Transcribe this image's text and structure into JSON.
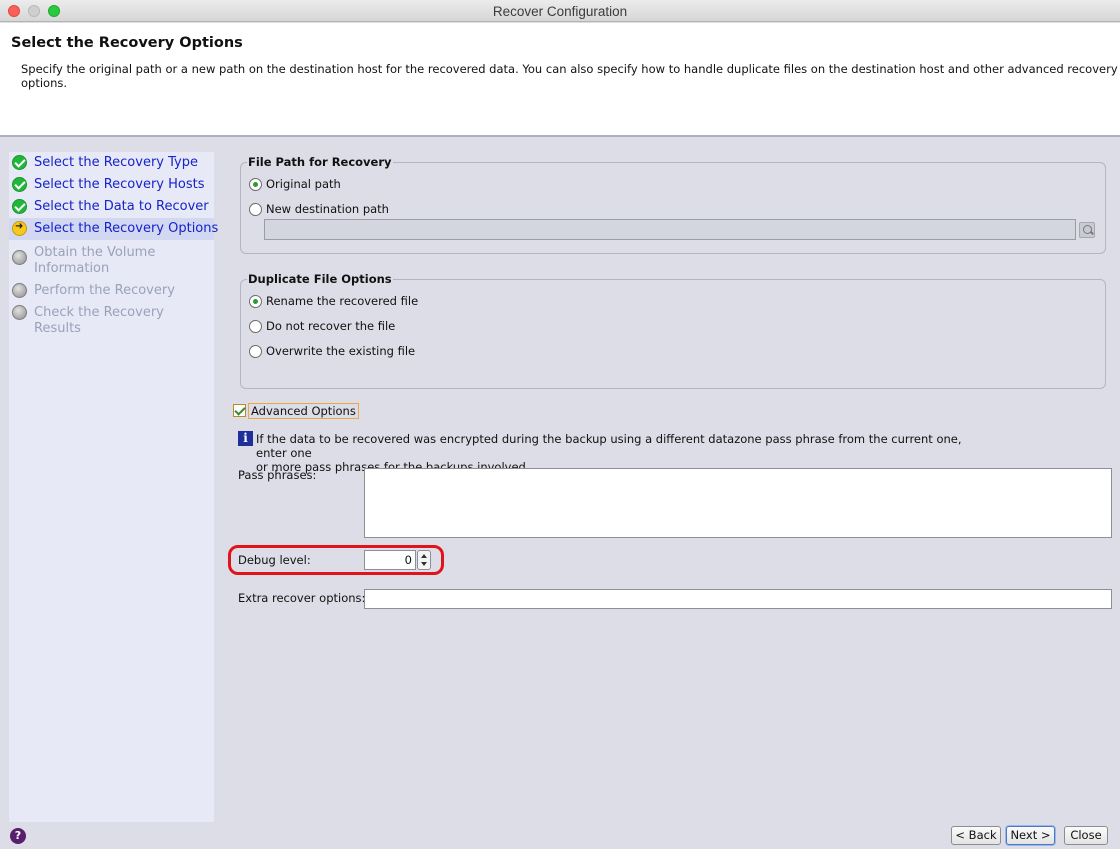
{
  "window": {
    "title": "Recover Configuration"
  },
  "header": {
    "title": "Select the Recovery Options",
    "description": "Specify the original path or a new path on the destination host for the recovered data. You can also specify how to handle duplicate files on the destination host and other advanced recovery options."
  },
  "steps": [
    {
      "label": "Select the Recovery Type",
      "status": "done"
    },
    {
      "label": "Select the Recovery Hosts",
      "status": "done"
    },
    {
      "label": "Select the Data to Recover",
      "status": "done"
    },
    {
      "label": "Select the Recovery Options",
      "status": "current"
    },
    {
      "label": "Obtain the Volume Information",
      "status": "pending"
    },
    {
      "label": "Perform the Recovery",
      "status": "pending"
    },
    {
      "label": "Check the Recovery Results",
      "status": "pending"
    }
  ],
  "file_path": {
    "title": "File Path for Recovery",
    "options": [
      {
        "label": "Original path",
        "selected": true
      },
      {
        "label": "New destination path",
        "selected": false
      }
    ],
    "destination_value": ""
  },
  "duplicate": {
    "title": "Duplicate File Options",
    "options": [
      {
        "label": "Rename the recovered file",
        "selected": true
      },
      {
        "label": "Do not recover the file",
        "selected": false
      },
      {
        "label": "Overwrite the existing file",
        "selected": false
      }
    ]
  },
  "advanced": {
    "label": "Advanced Options",
    "checked": true,
    "info_line1": "If the data to be recovered was encrypted during the backup using a different datazone pass phrase from the current one, enter one",
    "info_line2": "or more pass phrases for the backups involved.",
    "pass_label": "Pass phrases:",
    "debug_label": "Debug level:",
    "debug_value": "0",
    "extra_label": "Extra recover options:",
    "extra_value": ""
  },
  "buttons": {
    "back": "< Back",
    "next": "Next >",
    "close": "Close",
    "help": "?"
  },
  "colors": {
    "highlight": "#e1141c",
    "step_link": "#1623c9",
    "step_done": "#21b83a",
    "step_current": "#f6c91a"
  }
}
